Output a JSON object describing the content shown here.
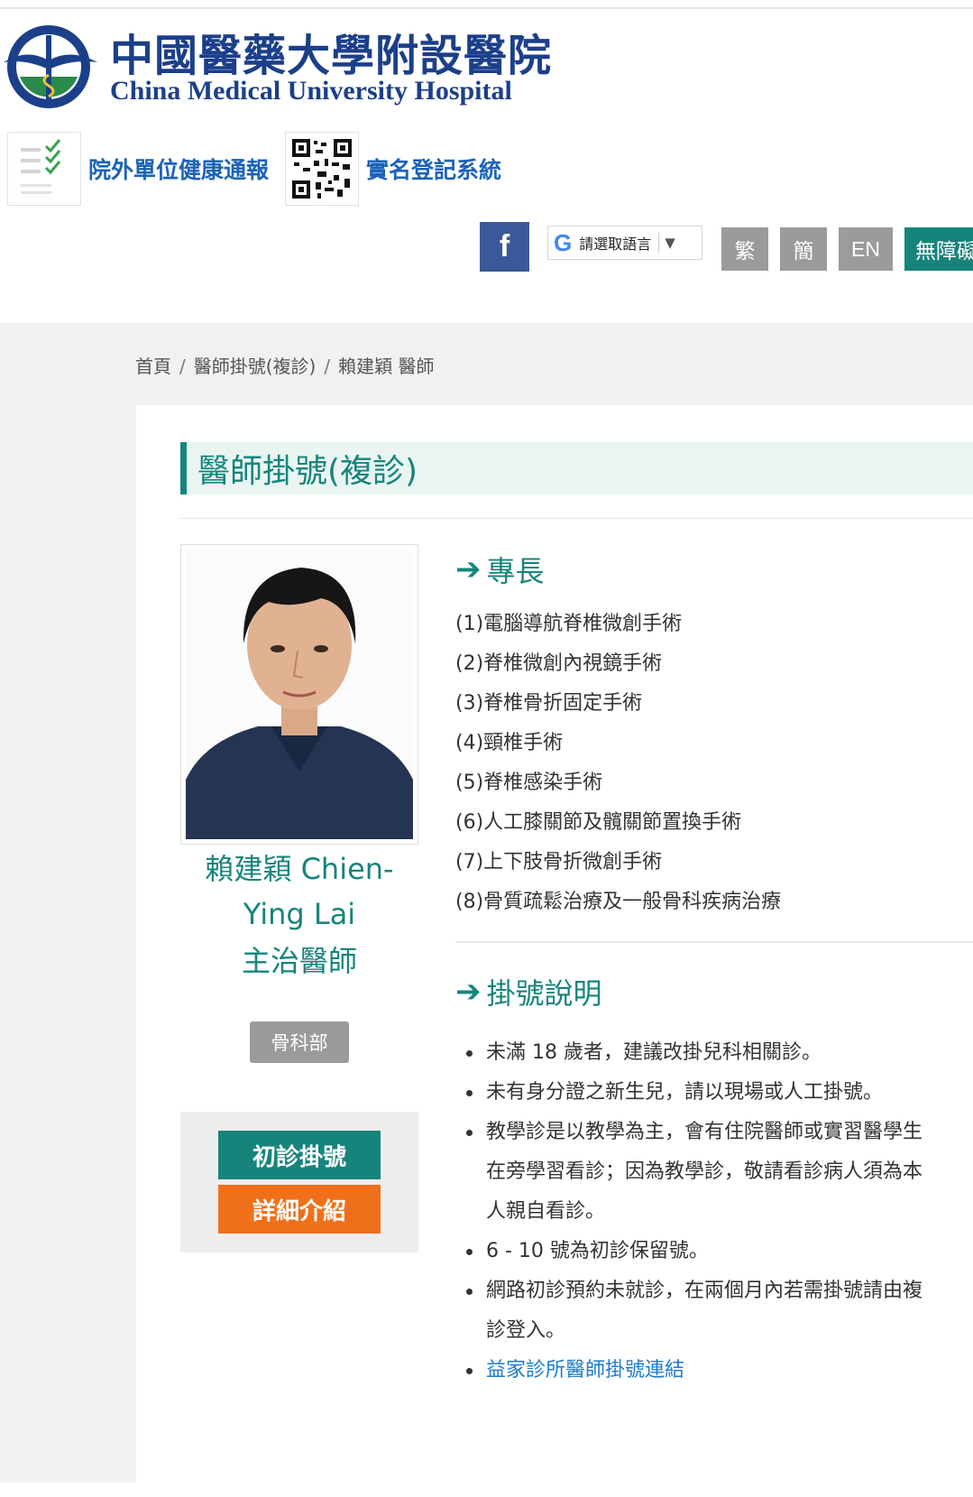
{
  "header": {
    "logo_cn": "中國醫藥大學附設醫院",
    "logo_en": "China Medical University Hospital",
    "quick_links": [
      {
        "label": "院外單位健康通報",
        "icon": "checklist-icon"
      },
      {
        "label": "實名登記系統",
        "icon": "qr-code-icon"
      }
    ],
    "facebook_icon": "facebook-icon",
    "translate": {
      "g": "G",
      "label": "請選取語言",
      "arrow": "▼"
    },
    "lang_buttons": [
      "繁",
      "簡",
      "EN"
    ],
    "accessibility": "無障礙"
  },
  "breadcrumb": [
    "首頁",
    "醫師掛號(複診)",
    "賴建穎 醫師"
  ],
  "breadcrumb_sep": "/",
  "page_title": "醫師掛號(複診)",
  "doctor": {
    "name_line1": "賴建穎 Chien-",
    "name_line2": "Ying Lai",
    "title": "主治醫師",
    "department": "骨科部",
    "first_visit_button": "初診掛號",
    "detail_button": "詳細介紹"
  },
  "specialty": {
    "heading": "專長",
    "items": [
      "(1)電腦導航脊椎微創手術",
      "(2)脊椎微創內視鏡手術",
      "(3)脊椎骨折固定手術",
      "(4)頸椎手術",
      "(5)脊椎感染手術",
      "(6)人工膝關節及髖關節置換手術",
      "(7)上下肢骨折微創手術",
      "(8)骨質疏鬆治療及一般骨科疾病治療"
    ]
  },
  "registration": {
    "heading": "掛號說明",
    "notes": [
      "未滿 18 歲者，建議改掛兒科相關診。",
      "未有身分證之新生兒，請以現場或人工掛號。",
      "教學診是以教學為主，會有住院醫師或實習醫學生在旁學習看診；因為教學診，敬請看診病人須為本人親自看診。",
      "6 - 10 號為初診保留號。",
      "網路初診預約未就診，在兩個月內若需掛號請由複診登入。"
    ],
    "link": "益家診所醫師掛號連結"
  },
  "colors": {
    "teal": "#17847c",
    "orange": "#f07019",
    "navy": "#1c3f8a",
    "link_blue": "#1b63b8",
    "facebook": "#3b5998",
    "gray_button": "#9b9b9b"
  }
}
